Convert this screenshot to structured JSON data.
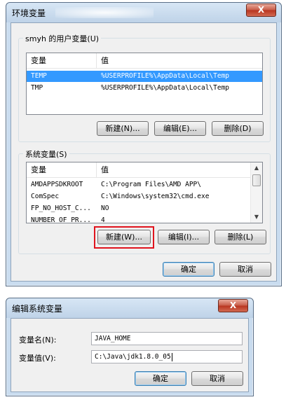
{
  "env_dialog": {
    "title": "环境变量",
    "close_label": "X",
    "user_group_label": "smyh 的用户变量(U)",
    "user_columns": [
      "变量",
      "值"
    ],
    "user_rows": [
      {
        "name": "TEMP",
        "value": "%USERPROFILE%\\AppData\\Local\\Temp",
        "selected": true
      },
      {
        "name": "TMP",
        "value": "%USERPROFILE%\\AppData\\Local\\Temp",
        "selected": false
      }
    ],
    "user_buttons": {
      "new": "新建(N)...",
      "edit": "编辑(E)...",
      "delete": "删除(D)"
    },
    "system_group_label": "系统变量(S)",
    "system_columns": [
      "变量",
      "值"
    ],
    "system_rows": [
      {
        "name": "AMDAPPSDKROOT",
        "value": "C:\\Program Files\\AMD APP\\"
      },
      {
        "name": "ComSpec",
        "value": "C:\\Windows\\system32\\cmd.exe"
      },
      {
        "name": "FP_NO_HOST_C...",
        "value": "NO"
      },
      {
        "name": "NUMBER_OF_PR...",
        "value": "4"
      }
    ],
    "system_buttons": {
      "new": "新建(W)...",
      "edit": "编辑(I)...",
      "delete": "删除(L)"
    },
    "ok": "确定",
    "cancel": "取消"
  },
  "edit_dialog": {
    "title": "编辑系统变量",
    "close_label": "X",
    "name_label": "变量名(N):",
    "name_value": "JAVA_HOME",
    "value_label": "变量值(V):",
    "value_value": "C:\\Java\\jdk1.8.0_05",
    "ok": "确定",
    "cancel": "取消"
  },
  "colors": {
    "selection": "#3399ff",
    "highlight_box": "#e0141e",
    "close_button": "#c75a45"
  }
}
